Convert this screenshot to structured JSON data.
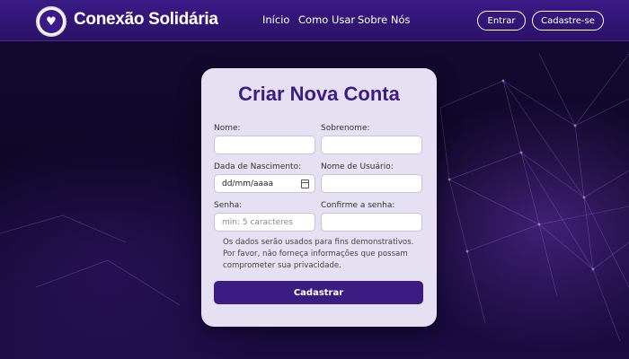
{
  "header": {
    "brand": "Conexão Solidária",
    "logo_icon": "heart-hands-icon",
    "nav": [
      "Início",
      "Como Usar",
      "Sobre Nós"
    ],
    "login_label": "Entrar",
    "signup_label": "Cadastre-se"
  },
  "form": {
    "title": "Criar Nova Conta",
    "first_name_label": "Nome:",
    "last_name_label": "Sobrenome:",
    "birthdate_label": "Dada de Nascimento:",
    "birthdate_placeholder": "dd/mm/aaaa",
    "username_label": "Nome de Usuário:",
    "password_label": "Senha:",
    "password_placeholder": "min: 5 caracteres",
    "confirm_label": "Confirme a senha:",
    "note": "Os dados serão usados para fins demonstrativos. Por favor, não forneça informações que possam comprometer sua privacidade.",
    "submit_label": "Cadastrar"
  },
  "colors": {
    "primary": "#3b1c83",
    "navbar": "#2b1266",
    "card": "#e6e0f3"
  }
}
